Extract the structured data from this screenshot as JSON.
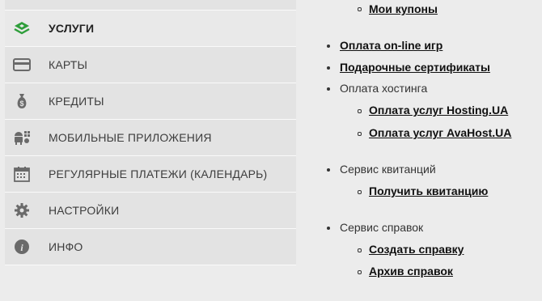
{
  "sidebar": {
    "items": [
      {
        "label": "УСЛУГИ",
        "icon": "services-stack-icon"
      },
      {
        "label": "КАРТЫ",
        "icon": "card-icon"
      },
      {
        "label": "КРЕДИТЫ",
        "icon": "money-bag-icon"
      },
      {
        "label": "МОБИЛЬНЫЕ ПРИЛОЖЕНИЯ",
        "icon": "mobile-apps-icon"
      },
      {
        "label": "РЕГУЛЯРНЫЕ ПЛАТЕЖИ (КАЛЕНДАРЬ)",
        "icon": "calendar-icon"
      },
      {
        "label": "НАСТРОЙКИ",
        "icon": "gear-icon"
      },
      {
        "label": "ИНФО",
        "icon": "info-icon"
      }
    ]
  },
  "content": {
    "my_coupons": "Мои купоны",
    "online_games": "Оплата on-line игр",
    "gift_certificates": "Подарочные сертификаты",
    "hosting_heading": "Оплата хостинга",
    "hosting_ua": "Оплата услуг Hosting.UA",
    "avahost": "Оплата услуг AvaHost.UA",
    "receipts_heading": "Сервис квитанций",
    "get_receipt": "Получить квитанцию",
    "certificates_heading": "Сервис справок",
    "create_certificate": "Создать справку",
    "certificates_archive": "Архив справок"
  },
  "colors": {
    "accent": "#2e9e3a",
    "icon_gray": "#6a6a6a"
  }
}
